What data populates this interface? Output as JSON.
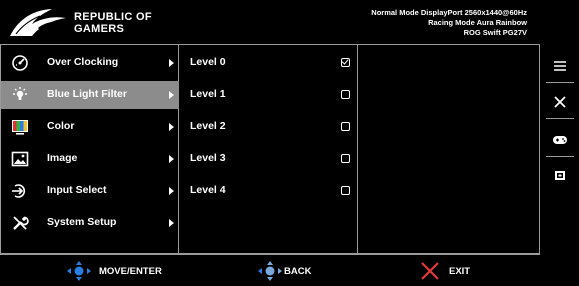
{
  "header": {
    "logo_line1": "REPUBLIC OF",
    "logo_line2": "GAMERS",
    "status_lines": [
      "Normal Mode DisplayPort 2560x1440@60Hz",
      "Racing Mode Aura Rainbow",
      "ROG Swift PG27V"
    ]
  },
  "menu": {
    "items": [
      {
        "label": "Over Clocking",
        "icon": "gauge-icon"
      },
      {
        "label": "Blue Light Filter",
        "icon": "light-bulb-icon",
        "selected": true
      },
      {
        "label": "Color",
        "icon": "color-bars-icon"
      },
      {
        "label": "Image",
        "icon": "image-icon"
      },
      {
        "label": "Input Select",
        "icon": "input-icon"
      },
      {
        "label": "System Setup",
        "icon": "wrench-icon"
      }
    ]
  },
  "submenu": {
    "items": [
      {
        "label": "Level 0",
        "checked": true
      },
      {
        "label": "Level 1",
        "checked": false
      },
      {
        "label": "Level 2",
        "checked": false
      },
      {
        "label": "Level 3",
        "checked": false
      },
      {
        "label": "Level 4",
        "checked": false
      }
    ]
  },
  "sidebar": {
    "icons": [
      "menu-icon",
      "close-icon",
      "gamepad-icon",
      "gamevisual-icon"
    ]
  },
  "footer": {
    "move_label": "MOVE/ENTER",
    "back_label": "BACK",
    "exit_label": "EXIT"
  },
  "colors": {
    "background": "#000000",
    "selected": "#8c8c8c",
    "border": "#9a9a9a",
    "accent_blue": "#2a7de1"
  }
}
